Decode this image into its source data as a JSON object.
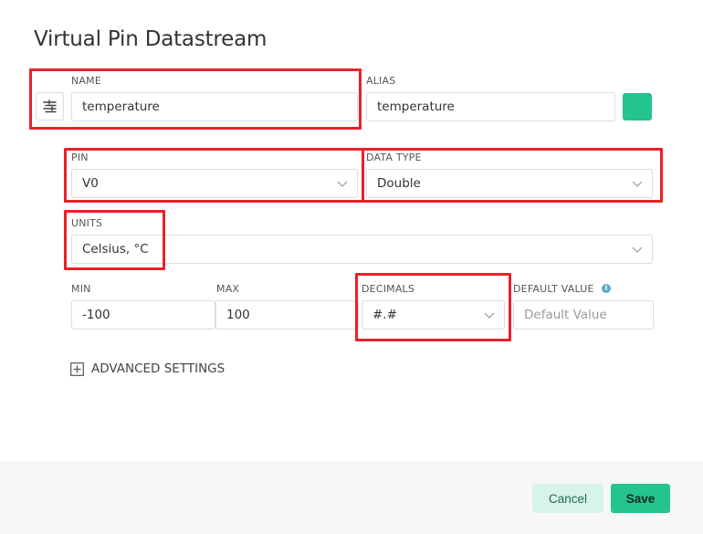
{
  "dialog": {
    "title": "Virtual Pin Datastream"
  },
  "name": {
    "label": "NAME",
    "value": "temperature"
  },
  "alias": {
    "label": "ALIAS",
    "value": "temperature"
  },
  "color": {
    "swatch": "#23c48e"
  },
  "pin": {
    "label": "PIN",
    "value": "V0"
  },
  "data_type": {
    "label": "DATA TYPE",
    "value": "Double"
  },
  "units": {
    "label": "UNITS",
    "value": "Celsius, °C"
  },
  "min": {
    "label": "MIN",
    "value": "-100"
  },
  "max": {
    "label": "MAX",
    "value": "100"
  },
  "decimals": {
    "label": "DECIMALS",
    "value": "#.#"
  },
  "default_value": {
    "label": "DEFAULT VALUE",
    "placeholder": "Default Value",
    "info_icon": "i"
  },
  "advanced": {
    "label": "ADVANCED SETTINGS"
  },
  "footer": {
    "cancel_label": "Cancel",
    "save_label": "Save"
  },
  "colors": {
    "accent": "#23c48e",
    "highlight": "#e8212b",
    "cancel_bg": "#d8f3ea"
  }
}
